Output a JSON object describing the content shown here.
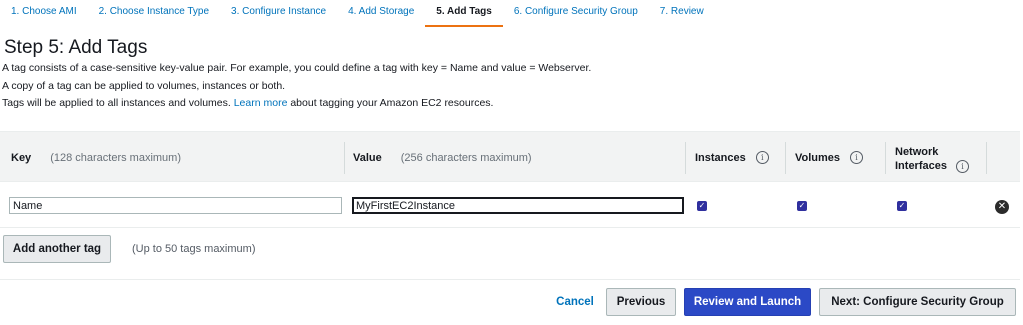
{
  "wizard": {
    "steps": [
      {
        "label": "1. Choose AMI"
      },
      {
        "label": "2. Choose Instance Type"
      },
      {
        "label": "3. Configure Instance"
      },
      {
        "label": "4. Add Storage"
      },
      {
        "label": "5. Add Tags"
      },
      {
        "label": "6. Configure Security Group"
      },
      {
        "label": "7. Review"
      }
    ],
    "active_step": "5. Add Tags"
  },
  "page": {
    "title": "Step 5: Add Tags",
    "line1": "A tag consists of a case-sensitive key-value pair. For example, you could define a tag with key = Name and value = Webserver.",
    "line2": "A copy of a tag can be applied to volumes, instances or both.",
    "line3_pre": "Tags will be applied to all instances and volumes. ",
    "line3_link": "Learn more",
    "line3_post": " about tagging your Amazon EC2 resources."
  },
  "table": {
    "headers": {
      "key": "Key",
      "key_hint": "(128 characters maximum)",
      "value": "Value",
      "value_hint": "(256 characters maximum)",
      "instances": "Instances",
      "volumes": "Volumes",
      "network_line1": "Network",
      "network_line2": "Interfaces",
      "info_symbol": "i"
    },
    "rows": [
      {
        "key": "Name",
        "value": "MyFirstEC2Instance",
        "instances_checked": true,
        "volumes_checked": true,
        "network_interfaces_checked": true
      }
    ]
  },
  "add_tag": {
    "button_label": "Add another tag",
    "limit_note": "(Up to 50 tags maximum)"
  },
  "footer": {
    "cancel": "Cancel",
    "previous": "Previous",
    "review_launch": "Review and Launch",
    "next": "Next: Configure Security Group"
  },
  "icons": {
    "checkbox": "check-icon",
    "remove": "remove-circle-icon",
    "info": "info-icon"
  },
  "colors": {
    "link": "#0073bb",
    "active_tab_underline": "#ec7211",
    "primary_button": "#2b49c6",
    "checkbox": "#2f2f9e"
  }
}
